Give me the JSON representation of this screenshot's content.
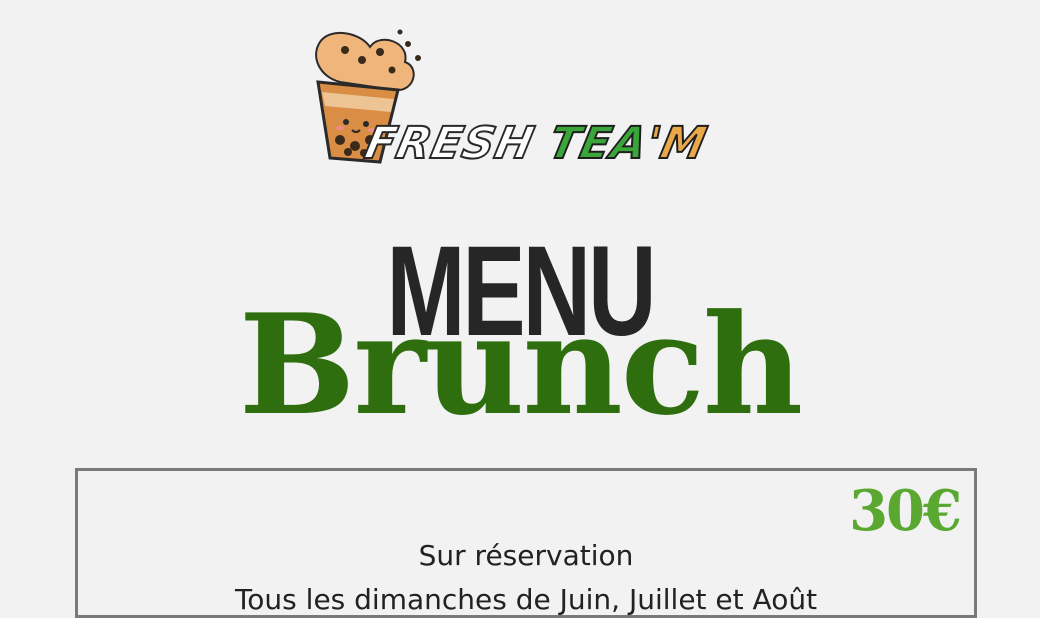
{
  "logo": {
    "word1": "FRESH",
    "word2": "TEA",
    "apostrophe": "'",
    "word3": "M",
    "icon": "bubble-tea-cup-icon"
  },
  "title": {
    "menu": "MENU",
    "brunch": "Brunch"
  },
  "card": {
    "price": "30€",
    "line1": "Sur réservation",
    "line2": "Tous les dimanches de Juin, Juillet et Août"
  },
  "colors": {
    "background": "#f2f2f2",
    "brunch_green": "#2f6e0f",
    "price_green": "#5aa832",
    "menu_dark": "#262626",
    "logo_green": "#3aa63a",
    "logo_orange": "#e9a84a"
  }
}
